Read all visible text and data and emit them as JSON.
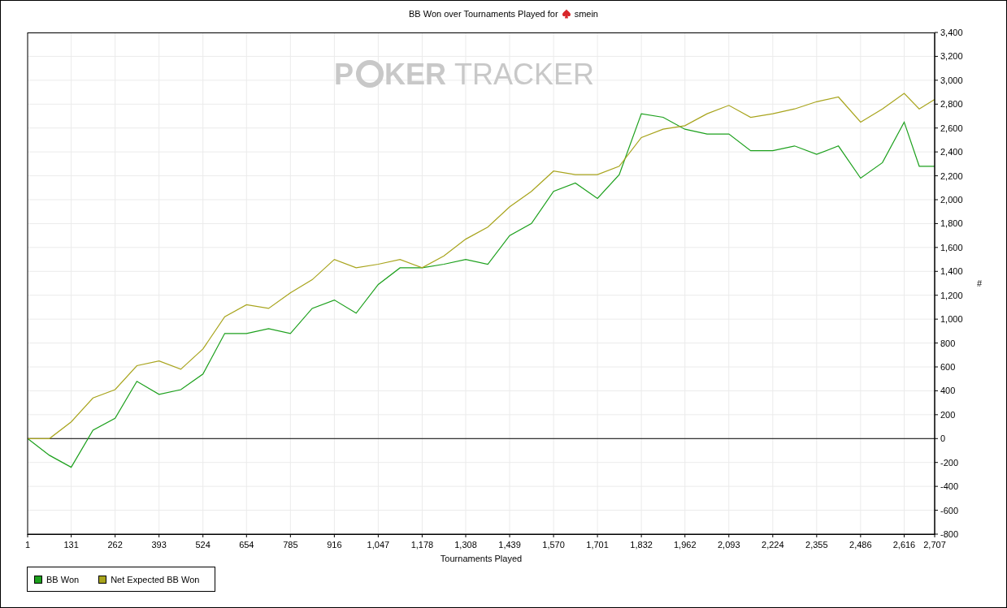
{
  "title": {
    "text": "BB Won over Tournaments Played for",
    "player": "smein"
  },
  "watermark": {
    "parts": [
      "P",
      "KER",
      "TRACKER"
    ]
  },
  "chart": {
    "chart_data": {
      "type": "line",
      "grid": true,
      "xlabel": "Tournaments Played",
      "ylabel": "#",
      "x": [
        1,
        66,
        131,
        196,
        262,
        327,
        393,
        458,
        524,
        589,
        654,
        720,
        785,
        850,
        916,
        981,
        1047,
        1112,
        1178,
        1243,
        1308,
        1374,
        1439,
        1504,
        1570,
        1635,
        1701,
        1766,
        1832,
        1897,
        1962,
        2028,
        2093,
        2158,
        2224,
        2289,
        2355,
        2420,
        2486,
        2551,
        2616,
        2661,
        2707
      ],
      "series": [
        {
          "name": "BB Won",
          "color": "#1ca01c",
          "values": [
            0,
            -140,
            -240,
            70,
            170,
            480,
            370,
            410,
            540,
            880,
            880,
            920,
            880,
            1090,
            1160,
            1050,
            1290,
            1430,
            1430,
            1460,
            1500,
            1460,
            1700,
            1800,
            2070,
            2140,
            2010,
            2210,
            2720,
            2690,
            2590,
            2550,
            2550,
            2410,
            2410,
            2450,
            2380,
            2450,
            2180,
            2310,
            2650,
            2280,
            2280
          ]
        },
        {
          "name": "Net Expected BB Won",
          "color": "#a8a41c",
          "values": [
            0,
            0,
            140,
            340,
            410,
            610,
            650,
            580,
            750,
            1020,
            1120,
            1090,
            1220,
            1330,
            1500,
            1430,
            1460,
            1500,
            1430,
            1530,
            1670,
            1770,
            1940,
            2070,
            2240,
            2210,
            2210,
            2280,
            2520,
            2590,
            2620,
            2720,
            2790,
            2690,
            2720,
            2760,
            2820,
            2860,
            2650,
            2760,
            2890,
            2760,
            2840
          ]
        }
      ],
      "xlim": [
        1,
        2707
      ],
      "ylim": [
        -800,
        3400
      ],
      "xticks": [
        {
          "value": 1,
          "label": "1"
        },
        {
          "value": 131,
          "label": "131"
        },
        {
          "value": 262,
          "label": "262"
        },
        {
          "value": 393,
          "label": "393"
        },
        {
          "value": 524,
          "label": "524"
        },
        {
          "value": 654,
          "label": "654"
        },
        {
          "value": 785,
          "label": "785"
        },
        {
          "value": 916,
          "label": "916"
        },
        {
          "value": 1047,
          "label": "1,047"
        },
        {
          "value": 1178,
          "label": "1,178"
        },
        {
          "value": 1308,
          "label": "1,308"
        },
        {
          "value": 1439,
          "label": "1,439"
        },
        {
          "value": 1570,
          "label": "1,570"
        },
        {
          "value": 1701,
          "label": "1,701"
        },
        {
          "value": 1832,
          "label": "1,832"
        },
        {
          "value": 1962,
          "label": "1,962"
        },
        {
          "value": 2093,
          "label": "2,093"
        },
        {
          "value": 2224,
          "label": "2,224"
        },
        {
          "value": 2355,
          "label": "2,355"
        },
        {
          "value": 2486,
          "label": "2,486"
        },
        {
          "value": 2616,
          "label": "2,616"
        },
        {
          "value": 2707,
          "label": "2,707"
        }
      ],
      "yticks": [
        {
          "value": 3400,
          "label": "3,400"
        },
        {
          "value": 3200,
          "label": "3,200"
        },
        {
          "value": 3000,
          "label": "3,000"
        },
        {
          "value": 2800,
          "label": "2,800"
        },
        {
          "value": 2600,
          "label": "2,600"
        },
        {
          "value": 2400,
          "label": "2,400"
        },
        {
          "value": 2200,
          "label": "2,200"
        },
        {
          "value": 2000,
          "label": "2,000"
        },
        {
          "value": 1800,
          "label": "1,800"
        },
        {
          "value": 1600,
          "label": "1,600"
        },
        {
          "value": 1400,
          "label": "1,400"
        },
        {
          "value": 1200,
          "label": "1,200"
        },
        {
          "value": 1000,
          "label": "1,000"
        },
        {
          "value": 800,
          "label": "800"
        },
        {
          "value": 600,
          "label": "600"
        },
        {
          "value": 400,
          "label": "400"
        },
        {
          "value": 200,
          "label": "200"
        },
        {
          "value": 0,
          "label": "0"
        },
        {
          "value": -200,
          "label": "-200"
        },
        {
          "value": -400,
          "label": "-400"
        },
        {
          "value": -600,
          "label": "-600"
        },
        {
          "value": -800,
          "label": "-800"
        }
      ]
    }
  }
}
